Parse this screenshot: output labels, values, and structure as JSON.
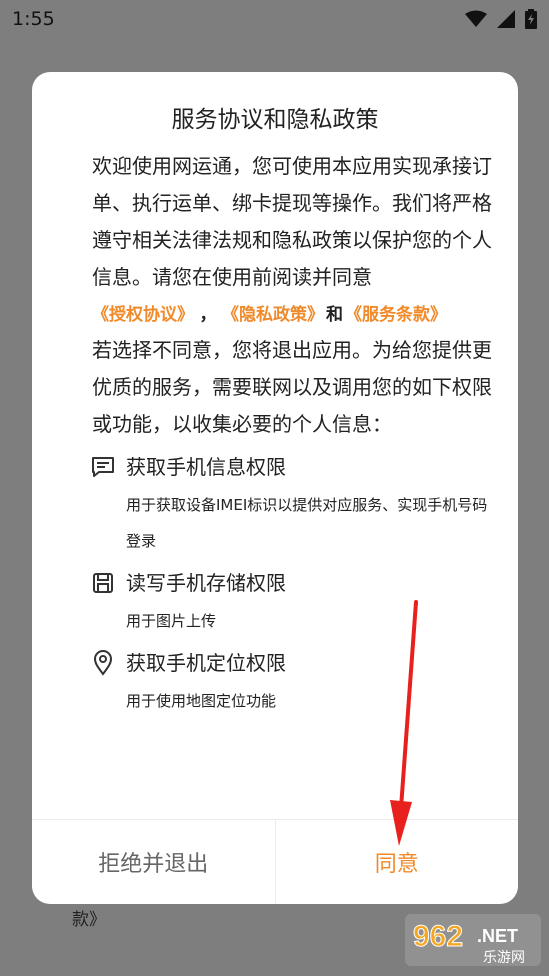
{
  "status_bar": {
    "time": "1:55"
  },
  "background_text": "款》",
  "dialog": {
    "title": "服务协议和隐私政策",
    "intro": "欢迎使用网运通，您可使用本应用实现承接订单、执行运单、绑卡提现等操作。我们将严格遵守相关法律法规和隐私政策以保护您的个人信息。请您在使用前阅读并同意",
    "links": {
      "auth": "《授权协议》",
      "sep": "，",
      "privacy": "《隐私政策》",
      "and": "和",
      "service": "《服务条款》"
    },
    "notice": "若选择不同意，您将退出应用。为给您提供更优质的服务，需要联网以及调用您的如下权限或功能，以收集必要的个人信息：",
    "permissions": [
      {
        "icon": "message-icon",
        "title": "获取手机信息权限",
        "desc": "用于获取设备IMEI标识以提供对应服务、实现手机号码登录"
      },
      {
        "icon": "save-icon",
        "title": "读写手机存储权限",
        "desc": "用于图片上传"
      },
      {
        "icon": "location-pin-icon",
        "title": "获取手机定位权限",
        "desc": "用于使用地图定位功能"
      }
    ],
    "reject_label": "拒绝并退出",
    "agree_label": "同意"
  },
  "colors": {
    "accent": "#f08a2a",
    "arrow": "#e8201e"
  },
  "watermark": {
    "number": "962",
    "suffix": ".NET",
    "text": "乐游网"
  }
}
